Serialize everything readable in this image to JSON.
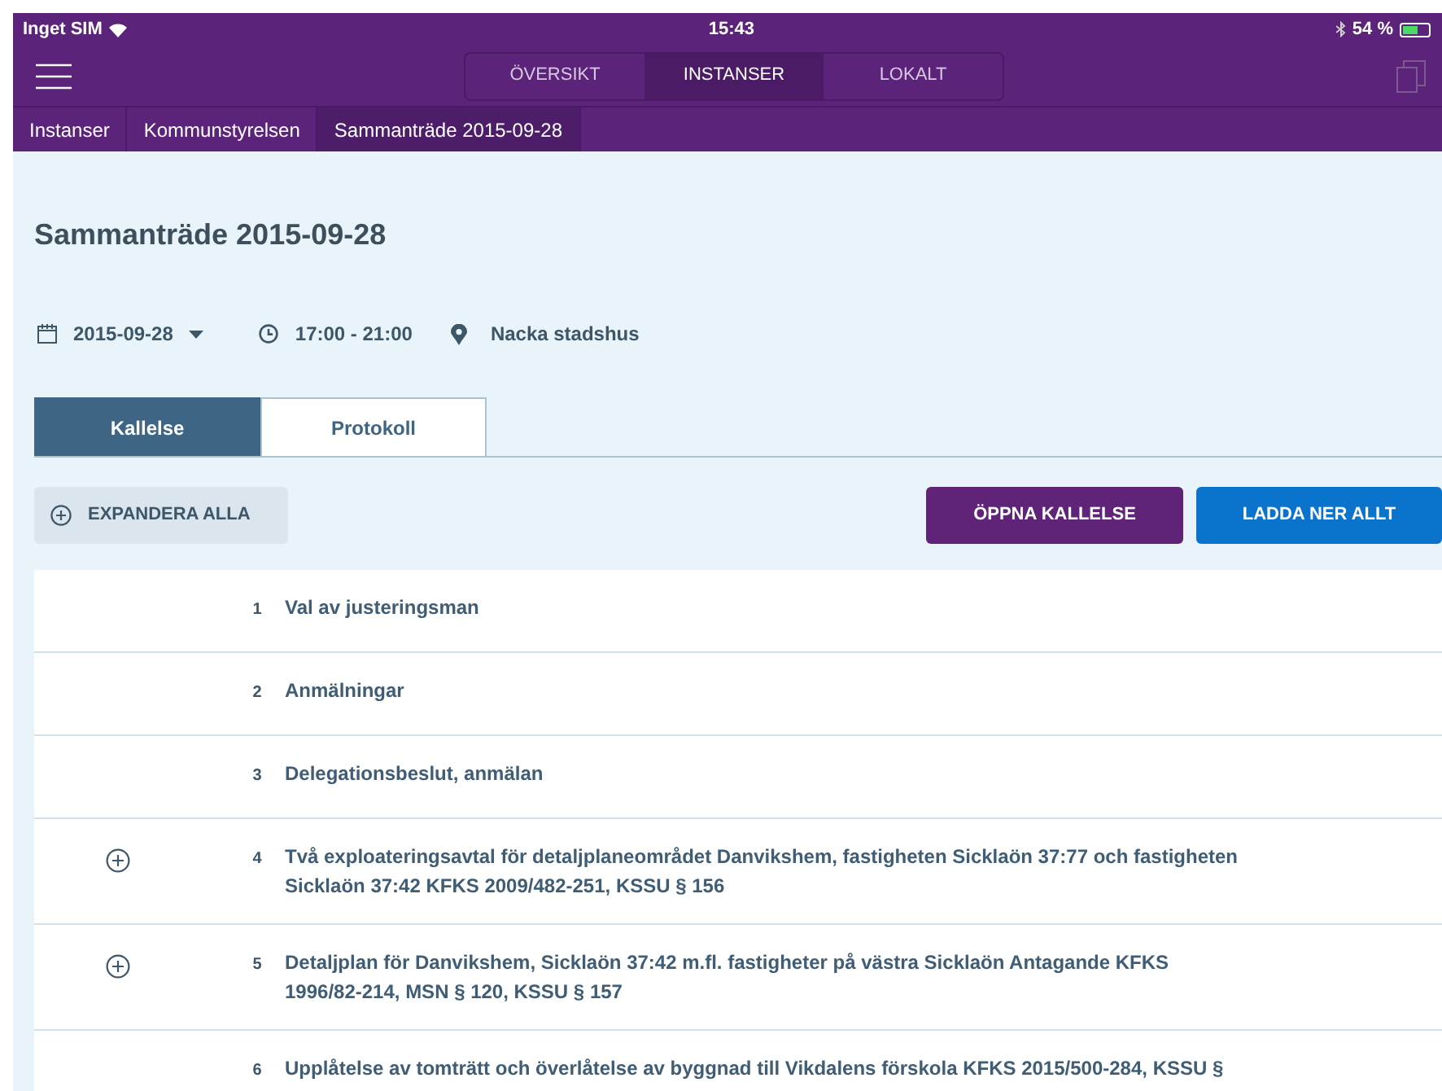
{
  "status_bar": {
    "carrier": "Inget SIM",
    "time": "15:43",
    "battery": "54 %"
  },
  "segments": [
    {
      "label": "ÖVERSIKT",
      "selected": false
    },
    {
      "label": "INSTANSER",
      "selected": true
    },
    {
      "label": "LOKALT",
      "selected": false
    }
  ],
  "breadcrumb": [
    {
      "label": "Instanser",
      "current": false
    },
    {
      "label": "Kommunstyrelsen",
      "current": false
    },
    {
      "label": "Sammanträde 2015-09-28",
      "current": true
    }
  ],
  "title": "Sammanträde 2015-09-28",
  "meta": {
    "date": "2015-09-28",
    "time": "17:00 - 21:00",
    "place": "Nacka stadshus"
  },
  "tabs": [
    {
      "label": "Kallelse",
      "selected": true
    },
    {
      "label": "Protokoll",
      "selected": false
    }
  ],
  "expand_all": "EXPANDERA ALLA",
  "buttons": [
    {
      "label": "ÖPPNA KALLELSE",
      "kind": "primary"
    },
    {
      "label": "LADDA NER ALLT",
      "kind": "secondary"
    }
  ],
  "items": [
    {
      "number": "1",
      "text": "Val av justeringsman",
      "expandable": false
    },
    {
      "number": "2",
      "text": "Anmälningar",
      "expandable": false
    },
    {
      "number": "3",
      "text": "Delegationsbeslut, anmälan",
      "expandable": false
    },
    {
      "number": "4",
      "text": "Två exploateringsavtal för detaljplaneområdet Danvikshem, fastigheten Sicklaön 37:77 och fastigheten Sicklaön 37:42 KFKS 2009/482-251, KSSU § 156",
      "expandable": true
    },
    {
      "number": "5",
      "text": "Detaljplan för Danvikshem, Sicklaön 37:42 m.fl. fastigheter på västra Sicklaön Antagande KFKS 1996/82-214, MSN § 120, KSSU § 157",
      "expandable": true
    },
    {
      "number": "6",
      "text": "Upplåtelse av tomträtt och överlåtelse av byggnad till Vikdalens förskola KFKS 2015/500-284, KSSU §",
      "expandable": false
    }
  ]
}
